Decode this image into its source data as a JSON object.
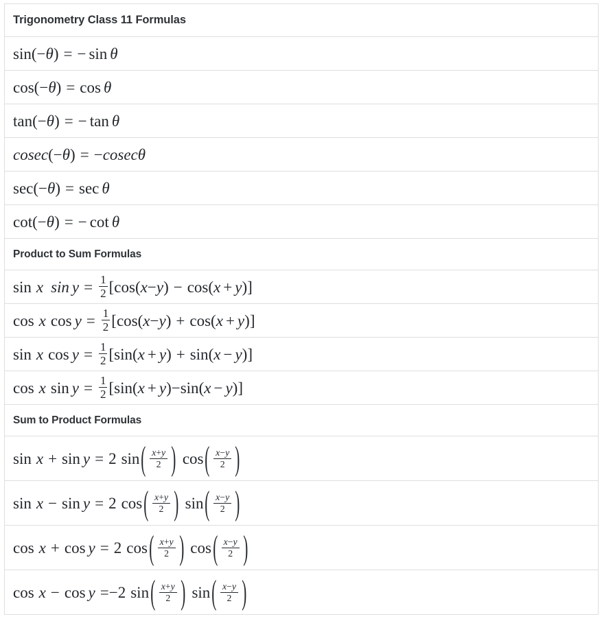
{
  "document": {
    "title": "Trigonometry Class 11 Formulas",
    "sections": [
      {
        "heading": "Trigonometry Class 11 Formulas",
        "is_main_title": true,
        "formulas": [
          {
            "id": "sin-neg",
            "text": "sin(−θ) = − sin θ"
          },
          {
            "id": "cos-neg",
            "text": "cos(−θ) = cos θ"
          },
          {
            "id": "tan-neg",
            "text": "tan(−θ) = − tan θ"
          },
          {
            "id": "cosec-neg",
            "text": "cosec(−θ) = −cosecθ"
          },
          {
            "id": "sec-neg",
            "text": "sec(−θ) = sec θ"
          },
          {
            "id": "cot-neg",
            "text": "cot(−θ) = − cot θ"
          }
        ]
      },
      {
        "heading": "Product to Sum Formulas",
        "is_main_title": false,
        "formulas": [
          {
            "id": "sin-sin",
            "text": "sin x  sin y = 1/2 [cos(x−y) − cos(x + y)]"
          },
          {
            "id": "cos-cos",
            "text": "cos x cos y = 1/2 [cos(x−y) + cos(x + y)]"
          },
          {
            "id": "sin-cos",
            "text": "sin x cos y = 1/2 [sin(x + y) + sin(x − y)]"
          },
          {
            "id": "cos-sin",
            "text": "cos x sin y = 1/2 [sin(x + y)−sin(x − y)]"
          }
        ]
      },
      {
        "heading": "Sum to Product Formulas",
        "is_main_title": false,
        "formulas": [
          {
            "id": "sin-plus-sin",
            "text": "sin x + sin y = 2 sin((x+y)/2) cos((x−y)/2)"
          },
          {
            "id": "sin-minus-sin",
            "text": "sin x − sin y = 2 cos((x+y)/2) sin((x−y)/2)"
          },
          {
            "id": "cos-plus-cos",
            "text": "cos x + cos y = 2 cos((x+y)/2) cos((x−y)/2)"
          },
          {
            "id": "cos-minus-cos",
            "text": "cos x − cos y =−2 sin((x+y)/2) sin((x−y)/2)"
          }
        ]
      }
    ],
    "symbols": {
      "theta": "θ",
      "minus": "−",
      "plus": "+",
      "equals": "=",
      "x": "x",
      "y": "y",
      "two": "2",
      "one": "1",
      "lbracket": "[",
      "rbracket": "]",
      "lparen": "(",
      "rparen": ")"
    },
    "function_names": {
      "sin": "sin",
      "cos": "cos",
      "tan": "tan",
      "cosec": "cosec",
      "sec": "sec",
      "cot": "cot"
    },
    "colors": {
      "text": "#23272b",
      "heading": "#2f3337",
      "border": "#dedede",
      "background": "#ffffff"
    }
  }
}
